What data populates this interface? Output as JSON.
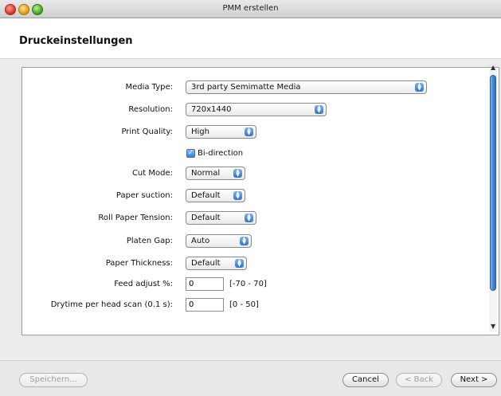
{
  "window": {
    "title": "PMM erstellen"
  },
  "page": {
    "title": "Druckeinstellungen"
  },
  "form": {
    "media_type": {
      "label": "Media Type:",
      "value": "3rd party Semimatte Media"
    },
    "resolution": {
      "label": "Resolution:",
      "value": "720x1440"
    },
    "print_quality": {
      "label": "Print Quality:",
      "value": "High"
    },
    "bi_direction": {
      "label": "Bi-direction",
      "checked": true
    },
    "cut_mode": {
      "label": "Cut Mode:",
      "value": "Normal"
    },
    "paper_suction": {
      "label": "Paper suction:",
      "value": "Default"
    },
    "roll_paper_tension": {
      "label": "Roll Paper Tension:",
      "value": "Default"
    },
    "platen_gap": {
      "label": "Platen Gap:",
      "value": "Auto"
    },
    "paper_thickness": {
      "label": "Paper Thickness:",
      "value": "Default"
    },
    "feed_adjust": {
      "label": "Feed adjust %:",
      "value": "0",
      "range": "[-70 - 70]"
    },
    "drytime": {
      "label": "Drytime per head scan (0.1 s):",
      "value": "0",
      "range": "[0 - 50]"
    }
  },
  "buttons": {
    "save": "Speichern...",
    "cancel": "Cancel",
    "back": "< Back",
    "next": "Next >"
  },
  "colors": {
    "accent": "#3a83d8"
  }
}
